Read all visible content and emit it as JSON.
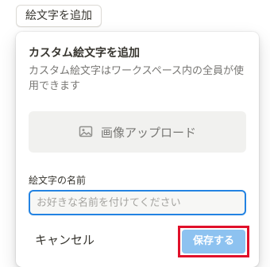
{
  "trigger": {
    "label": "絵文字を追加"
  },
  "dialog": {
    "title": "カスタム絵文字を追加",
    "description": "カスタム絵文字はワークスペース内の全員が使用できます",
    "upload": {
      "label": "画像アップロード",
      "icon": "image-icon"
    },
    "name_field": {
      "label": "絵文字の名前",
      "value": "",
      "placeholder": "お好きな名前を付けてください"
    },
    "cancel_label": "キャンセル",
    "save_label": "保存する"
  },
  "colors": {
    "accent": "#2383e2",
    "save_button_disabled": "#8dc2f0",
    "highlight_box": "#e0102a"
  }
}
